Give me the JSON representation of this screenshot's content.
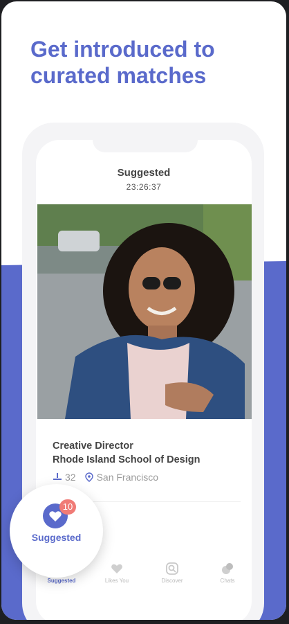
{
  "promo": {
    "headline_line1": "Get introduced to",
    "headline_line2": "curated matches"
  },
  "screen": {
    "title": "Suggested",
    "timer": "23:26:37"
  },
  "profile": {
    "job_title": "Creative Director",
    "school": "Rhode Island School of Design",
    "age": "32",
    "location": "San Francisco"
  },
  "tabs": [
    {
      "label": "Suggested",
      "icon": "heart-icon",
      "badge": "10"
    },
    {
      "label": "Likes You",
      "icon": "heart-icon"
    },
    {
      "label": "Discover",
      "icon": "search-icon"
    },
    {
      "label": "Chats",
      "icon": "chat-bubbles-icon"
    }
  ],
  "bubble": {
    "label": "Suggested",
    "badge": "10"
  },
  "colors": {
    "brand": "#5a6acb",
    "badge": "#f07b76",
    "text": "#444444",
    "muted": "#9a9a9a"
  }
}
